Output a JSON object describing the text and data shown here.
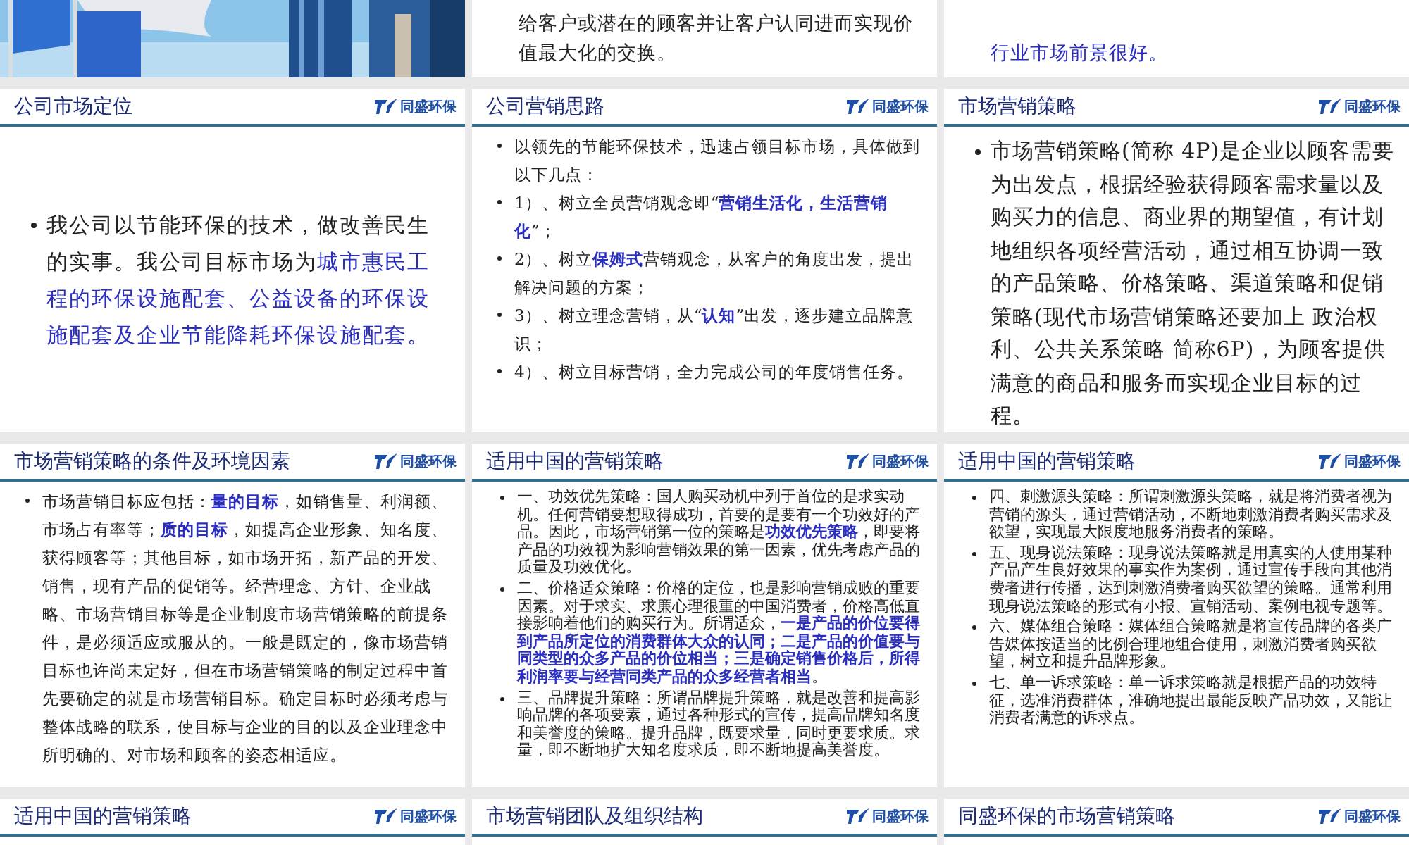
{
  "slides": [
    {
      "kind": "picture"
    },
    {
      "kind": "continuation",
      "text": "给客户或潜在的顾客并让客户认同进而实现价值最大化的交换。"
    },
    {
      "kind": "continuation-highlight",
      "text": "行业市场前景很好。"
    },
    {
      "kind": "large",
      "title": "公司市场定位",
      "logo_text": "同盛环保",
      "bullets": [
        "我公司以节能环保的技术，做改善民生的实事。我公司目标市场为**城市惠民工程的环保设施配套、公益设备的环保设施配套及企业节能降耗环保设施配套。**"
      ]
    },
    {
      "kind": "medium",
      "title": "公司营销思路",
      "logo_text": "同盛环保",
      "bullets": [
        "以领先的节能环保技术，迅速占领目标市场，具体做到以下几点：",
        "1）、树立全员营销观念即“**营销生活化，生活营销化**”；",
        "2）、树立**保姆式**营销观念，从客户的角度出发，提出解决问题的方案；",
        "3）、树立理念营销，从“**认知**”出发，逐步建立品牌意识；",
        "4）、树立目标营销，全力完成公司的年度销售任务。"
      ]
    },
    {
      "kind": "large-top",
      "title": "市场营销策略",
      "logo_text": "同盛环保",
      "bullets": [
        "市场营销策略(简称 4P)是企业以顾客需要为出发点，根据经验获得顾客需求量以及购买力的信息、商业界的期望值，有计划地组织各项经营活动，通过相互协调一致的产品策略、价格策略、渠道策略和促销策略(现代市场营销策略还要加上 政治权利、公共关系策略 简称6P)，为顾客提供满意的商品和服务而实现企业目标的过程。"
      ]
    },
    {
      "kind": "medium",
      "title": "市场营销策略的条件及环境因素",
      "logo_text": "同盛环保",
      "bullets": [
        "市场营销目标应包括：**量的目标**，如销售量、利润额、市场占有率等；**质的目标**，如提高企业形象、知名度、获得顾客等；其他目标，如市场开拓，新产品的开发、销售，现有产品的促销等。经营理念、方针、企业战略、市场营销目标等是企业制度市场营销策略的前提条件，是必须适应或服从的。一般是既定的，像市场营销目标也许尚未定好，但在市场营销策略的制定过程中首先要确定的就是市场营销目标。确定目标时必须考虑与整体战略的联系，使目标与企业的目的以及企业理念中所明确的、对市场和顾客的姿态相适应。"
      ]
    },
    {
      "kind": "dense",
      "title": "适用中国的营销策略",
      "logo_text": "同盛环保",
      "bullets": [
        "一、功效优先策略：国人购买动机中列于首位的是求实动机。任何营销要想取得成功，首要的是要有一个功效好的产品。因此，市场营销第一位的策略是**功效优先策略**，即要将产品的功效视为影响营销效果的第一因素，优先考虑产品的质量及功效优化。",
        "二、价格适众策略：价格的定位，也是影响营销成败的重要因素。对于求实、求廉心理很重的中国消费者，价格高低直接影响着他们的购买行为。所谓适众，**一是产品的价位要得到产品所定位的消费群体大众的认同；二是产品的价值要与同类型的众多产品的价位相当；三是确定销售价格后，所得利润率要与经营同类产品的众多经营者相当**。",
        "三、品牌提升策略：所谓品牌提升策略，就是改善和提高影响品牌的各项要素，通过各种形式的宣传，提高品牌知名度和美誉度的策略。提升品牌，既要求量，同时更要求质。求量，即不断地扩大知名度求质，即不断地提高美誉度。"
      ]
    },
    {
      "kind": "dense",
      "title": "适用中国的营销策略",
      "logo_text": "同盛环保",
      "bullets": [
        "四、刺激源头策略：所谓刺激源头策略，就是将消费者视为营销的源头，通过营销活动，不断地刺激消费者购买需求及欲望，实现最大限度地服务消费者的策略。",
        "五、现身说法策略：现身说法策略就是用真实的人使用某种产品产生良好效果的事实作为案例，通过宣传手段向其他消费者进行传播，达到刺激消费者购买欲望的策略。通常利用现身说法策略的形式有小报、宣销活动、案例电视专题等。",
        "六、媒体组合策略：媒体组合策略就是将宣传品牌的各类广告媒体按适当的比例合理地组合使用，刺激消费者购买欲望，树立和提升品牌形象。",
        "七、单一诉求策略：单一诉求策略就是根据产品的功效特征，选准消费群体，准确地提出最能反映产品功效，又能让消费者满意的诉求点。"
      ]
    },
    {
      "kind": "title-only",
      "title": "适用中国的营销策略",
      "logo_text": "同盛环保"
    },
    {
      "kind": "title-only",
      "title": "市场营销团队及组织结构",
      "logo_text": "同盛环保"
    },
    {
      "kind": "title-only",
      "title": "同盛环保的市场营销策略",
      "logo_text": "同盛环保"
    }
  ]
}
